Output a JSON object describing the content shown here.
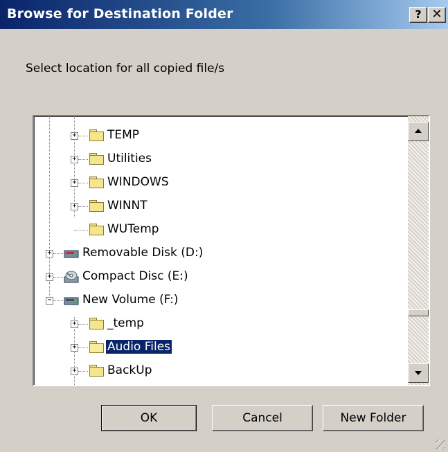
{
  "window": {
    "title": "Browse for Destination Folder",
    "help_label": "?",
    "close_label": "✕"
  },
  "prompt": "Select location for all copied file/s",
  "tree": {
    "items": [
      {
        "label": "TEMP",
        "icon": "folder-icon",
        "expander": "+"
      },
      {
        "label": "Utilities",
        "icon": "folder-icon",
        "expander": "+"
      },
      {
        "label": "WINDOWS",
        "icon": "folder-icon",
        "expander": "+"
      },
      {
        "label": "WINNT",
        "icon": "folder-icon",
        "expander": "+"
      },
      {
        "label": "WUTemp",
        "icon": "folder-icon",
        "expander": ""
      },
      {
        "label": "Removable Disk (D:)",
        "icon": "removable-disk-icon",
        "expander": "+"
      },
      {
        "label": "Compact Disc (E:)",
        "icon": "cd-drive-icon",
        "expander": "+"
      },
      {
        "label": "New Volume (F:)",
        "icon": "hard-drive-icon",
        "expander": "−"
      },
      {
        "label": "_temp",
        "icon": "folder-icon",
        "expander": "+"
      },
      {
        "label": "Audio Files",
        "icon": "open-folder-icon",
        "expander": "+",
        "selected": true
      },
      {
        "label": "BackUp",
        "icon": "folder-icon",
        "expander": "+"
      }
    ]
  },
  "buttons": {
    "ok": "OK",
    "cancel": "Cancel",
    "new_folder": "New Folder"
  },
  "colors": {
    "title_start": "#0a246a",
    "title_end": "#a6caf0",
    "face": "#d4d0c8",
    "selection": "#0a246a"
  }
}
